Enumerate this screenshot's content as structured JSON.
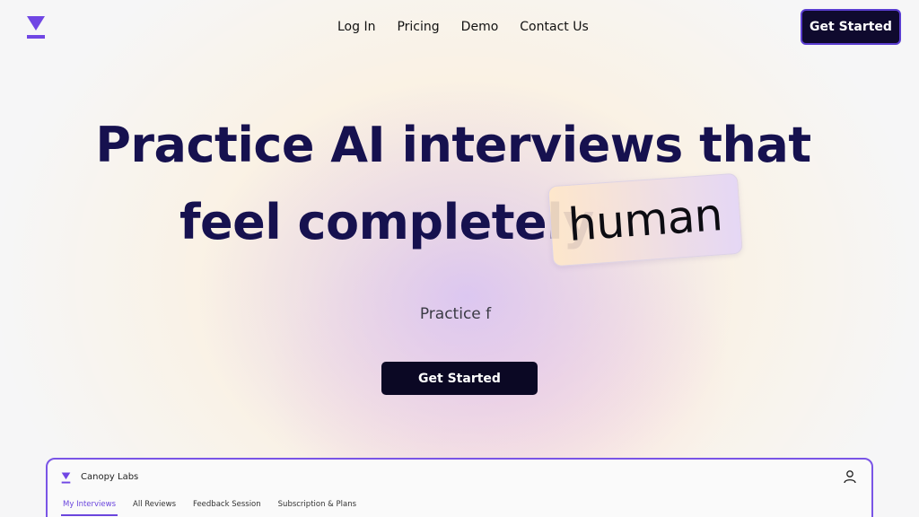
{
  "nav": {
    "logo_icon": "canopy-triangle-logo",
    "links": [
      "Log In",
      "Pricing",
      "Demo",
      "Contact Us"
    ],
    "cta": "Get Started"
  },
  "hero": {
    "line1": "Practice AI interviews that",
    "line2": "feel completely",
    "highlight": "human",
    "subtitle": "Practice f",
    "cta": "Get Started"
  },
  "preview": {
    "app_name": "Canopy Labs",
    "tabs": [
      "My Interviews",
      "All Reviews",
      "Feedback Session",
      "Subscription & Plans"
    ],
    "active_tab": "My Interviews",
    "user_icon": "user-icon"
  },
  "colors": {
    "accent": "#6a45dd",
    "dark": "#0f0a2e",
    "heading": "#16114f"
  }
}
